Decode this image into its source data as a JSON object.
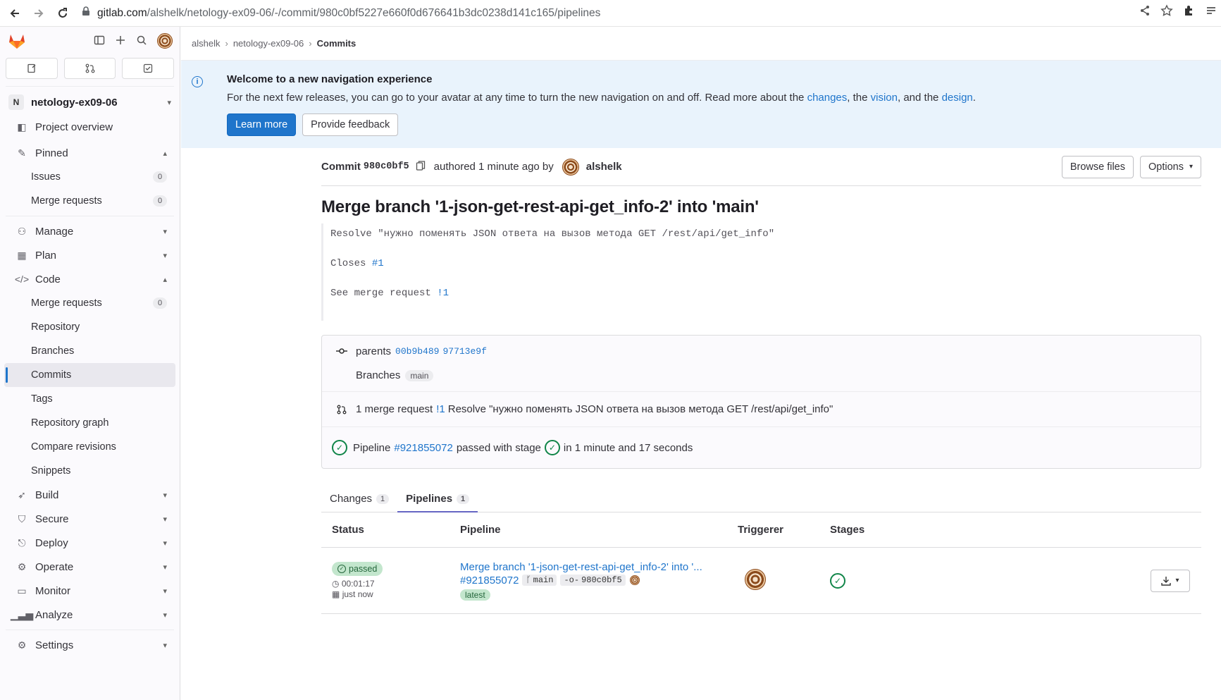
{
  "browser": {
    "url_host": "gitlab.com",
    "url_path": "/alshelk/netology-ex09-06/-/commit/980c0bf5227e660f0d676641b3dc0238d141c165/pipelines"
  },
  "sidebar": {
    "project_initial": "N",
    "project_name": "netology-ex09-06",
    "overview": "Project overview",
    "pinned": "Pinned",
    "pinned_items": [
      {
        "label": "Issues",
        "count": "0"
      },
      {
        "label": "Merge requests",
        "count": "0"
      }
    ],
    "manage": "Manage",
    "plan": "Plan",
    "code": "Code",
    "code_items": [
      {
        "label": "Merge requests",
        "count": "0"
      },
      {
        "label": "Repository"
      },
      {
        "label": "Branches"
      },
      {
        "label": "Commits"
      },
      {
        "label": "Tags"
      },
      {
        "label": "Repository graph"
      },
      {
        "label": "Compare revisions"
      },
      {
        "label": "Snippets"
      }
    ],
    "build": "Build",
    "secure": "Secure",
    "deploy": "Deploy",
    "operate": "Operate",
    "monitor": "Monitor",
    "analyze": "Analyze",
    "settings": "Settings"
  },
  "breadcrumb": [
    "alshelk",
    "netology-ex09-06",
    "Commits"
  ],
  "banner": {
    "title": "Welcome to a new navigation experience",
    "text_1": "For the next few releases, you can go to your avatar at any time to turn the new navigation on and off. Read more about the ",
    "link_changes": "changes",
    "text_2": ", the ",
    "link_vision": "vision",
    "text_3": ", and the ",
    "link_design": "design",
    "text_4": ".",
    "learn_more": "Learn more",
    "feedback": "Provide feedback"
  },
  "commit": {
    "label": "Commit",
    "short_sha": "980c0bf5",
    "authored": "authored 1 minute ago by",
    "author": "alshelk",
    "browse_files": "Browse files",
    "options": "Options",
    "title": "Merge branch '1-json-get-rest-api-get_info-2' into 'main'",
    "desc_line1": "Resolve \"нужно поменять JSON ответа на вызов метода GET /rest/api/get_info\"",
    "desc_closes": "Closes ",
    "desc_closes_link": "#1",
    "desc_see": "See merge request ",
    "desc_see_link": "!1",
    "parents_label": "parents",
    "parent_1": "00b9b489",
    "parent_2": "97713e9f",
    "branches_label": "Branches",
    "branch": "main",
    "mr_count_text": "1 merge request",
    "mr_link": "!1",
    "mr_title": "Resolve \"нужно поменять JSON ответа на вызов метода GET /rest/api/get_info\"",
    "pipeline_label": "Pipeline",
    "pipeline_link": "#921855072",
    "pipeline_passed": "passed with stage",
    "pipeline_duration": "in 1 minute and 17 seconds"
  },
  "tabs": [
    {
      "label": "Changes",
      "count": "1"
    },
    {
      "label": "Pipelines",
      "count": "1"
    }
  ],
  "table": {
    "headers": [
      "Status",
      "Pipeline",
      "Triggerer",
      "Stages"
    ],
    "row": {
      "status": "passed",
      "duration": "00:01:17",
      "time": "just now",
      "title": "Merge branch '1-json-get-rest-api-get_info-2' into '...",
      "id": "#921855072",
      "ref": "main",
      "sha": "980c0bf5",
      "tag": "latest"
    }
  }
}
